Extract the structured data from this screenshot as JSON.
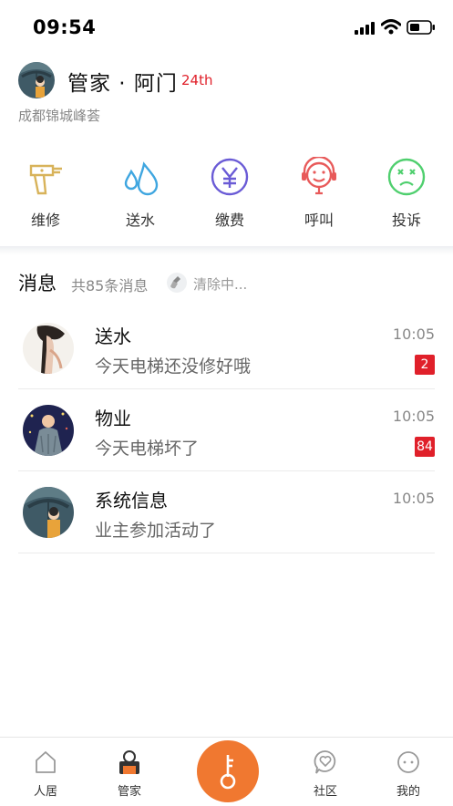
{
  "status_bar": {
    "time": "09:54"
  },
  "header": {
    "title": "管家 · 阿门",
    "tag": "24th",
    "community": "成都锦城峰荟"
  },
  "services": [
    {
      "label": "维修",
      "icon": "drill-icon",
      "color": "#d8b35a"
    },
    {
      "label": "送水",
      "icon": "water-drop-icon",
      "color": "#3fa6e0"
    },
    {
      "label": "缴费",
      "icon": "yuan-icon",
      "color": "#6a5bd6"
    },
    {
      "label": "呼叫",
      "icon": "headset-icon",
      "color": "#e85a5a"
    },
    {
      "label": "投诉",
      "icon": "sad-face-icon",
      "color": "#4fcf6e"
    }
  ],
  "messages": {
    "title": "消息",
    "count_text": "共85条消息",
    "clear_label": "清除中...",
    "items": [
      {
        "name": "送水",
        "preview": "今天电梯还没修好哦",
        "time": "10:05",
        "badge": "2"
      },
      {
        "name": "物业",
        "preview": "今天电梯坏了",
        "time": "10:05",
        "badge": "84"
      },
      {
        "name": "系统信息",
        "preview": "业主参加活动了",
        "time": "10:05",
        "badge": ""
      }
    ]
  },
  "tabbar": {
    "items": [
      {
        "label": "人居",
        "icon": "home-icon"
      },
      {
        "label": "管家",
        "icon": "butler-icon"
      },
      {
        "label": "社区",
        "icon": "community-heart-icon"
      },
      {
        "label": "我的",
        "icon": "profile-icon"
      }
    ],
    "center_icon": "key-icon"
  },
  "colors": {
    "accent": "#f07830",
    "badge": "#e0202a"
  }
}
